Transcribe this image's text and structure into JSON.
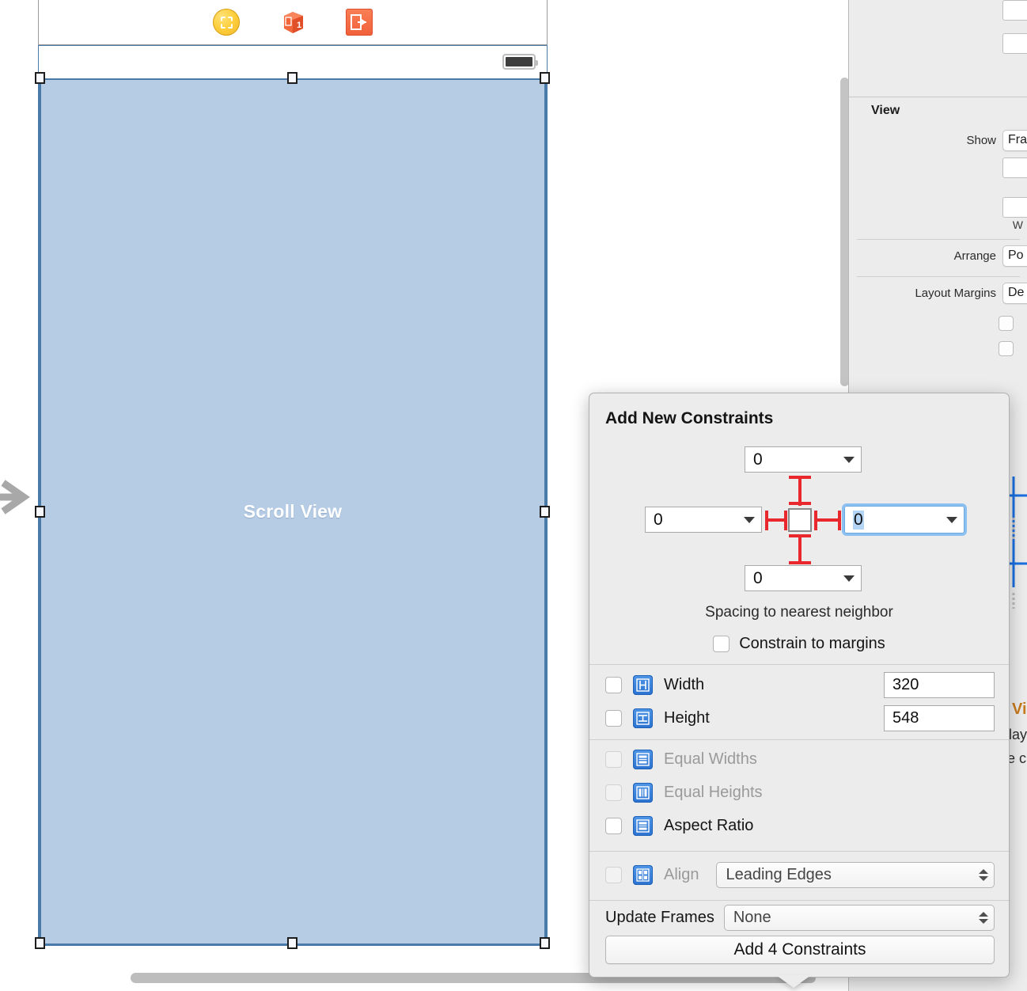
{
  "scene_dock": {
    "icons": [
      {
        "name": "view-controller-icon",
        "label": "View Controller"
      },
      {
        "name": "first-responder-icon",
        "label": "First Responder",
        "badge": "1"
      },
      {
        "name": "exit-icon",
        "label": "Exit"
      }
    ]
  },
  "canvas": {
    "scroll_view_label": "Scroll View",
    "status_bar": {
      "battery": "battery-icon"
    },
    "entry_point": "storyboard-entry-point-arrow"
  },
  "inspector": {
    "section_title": "View",
    "rows": [
      {
        "label": "Show",
        "value": "Fra"
      },
      {
        "label": "Arrange",
        "value": "Po"
      },
      {
        "label": "Layout Margins",
        "value": "De"
      }
    ],
    "clipped_text": {
      "line1": "Vi",
      "line2": "lay",
      "line3": "e c"
    }
  },
  "popover": {
    "title": "Add New Constraints",
    "spacing": {
      "top": "0",
      "leading": "0",
      "trailing": "0",
      "bottom": "0",
      "caption": "Spacing to nearest neighbor",
      "constrain_to_margins": "Constrain to margins",
      "focused_field": "trailing"
    },
    "size_rows": [
      {
        "id": "width",
        "label": "Width",
        "value": "320",
        "checked": false,
        "enabled": true,
        "icon": "width-constraint-icon"
      },
      {
        "id": "height",
        "label": "Height",
        "value": "548",
        "checked": false,
        "enabled": true,
        "icon": "height-constraint-icon"
      }
    ],
    "relation_rows": [
      {
        "id": "equal-widths",
        "label": "Equal Widths",
        "checked": false,
        "enabled": false,
        "icon": "equal-widths-icon"
      },
      {
        "id": "equal-heights",
        "label": "Equal Heights",
        "checked": false,
        "enabled": false,
        "icon": "equal-heights-icon"
      },
      {
        "id": "aspect-ratio",
        "label": "Aspect Ratio",
        "checked": false,
        "enabled": true,
        "icon": "aspect-ratio-icon"
      }
    ],
    "align": {
      "label": "Align",
      "value": "Leading Edges",
      "enabled": false,
      "icon": "align-icon"
    },
    "update_frames": {
      "label": "Update Frames",
      "value": "None"
    },
    "submit_label": "Add 4 Constraints"
  },
  "colors": {
    "scroll_view_fill": "#b6cce5",
    "selection_stroke": "#4a7ba8",
    "popover_bg": "#ececec",
    "constraint_red": "#e8282d",
    "focus_blue": "#8cc0f0",
    "icon_blue": "#2a72cf"
  }
}
